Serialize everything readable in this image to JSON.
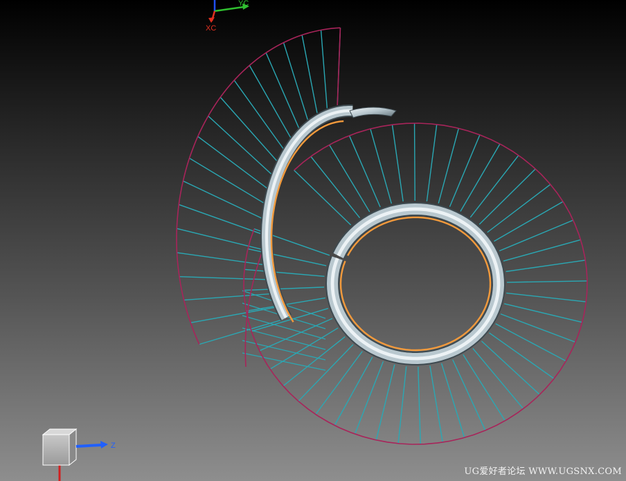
{
  "viewport": {
    "background_top": "#000000",
    "background_bottom": "#8e8e8e"
  },
  "wcs_triad": {
    "x_label": "XC",
    "y_label": "YC",
    "x_color": "#e03020",
    "y_color": "#30c030",
    "z_color": "#2050ff"
  },
  "view_triad": {
    "z_label": "Z",
    "z_color": "#2060ff",
    "vertical_axis_color": "#d02020"
  },
  "model": {
    "edge_color": "#a8245a",
    "step_line_color": "#2aa8b4",
    "tube_color": "#b9c8cf",
    "centerline_color": "#f29a3c",
    "upper_spiral_step_lines": 18,
    "lower_spiral_step_lines": 45
  },
  "watermark": {
    "text": "UG爱好者论坛 WWW.UGSNX.COM"
  }
}
